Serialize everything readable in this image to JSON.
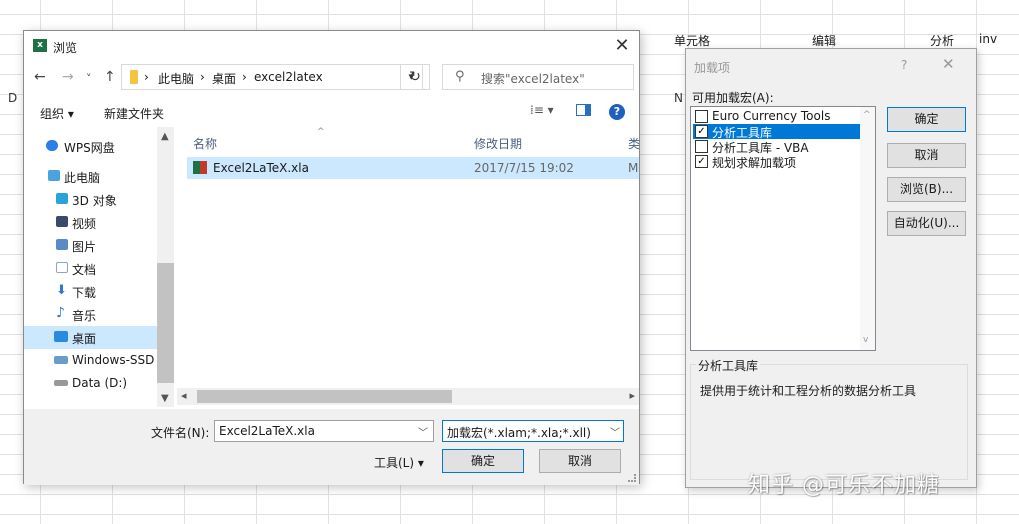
{
  "excel": {
    "ribbon": {
      "cell": "单元格",
      "edit": "编辑",
      "analyze": "分析",
      "inv": "inv"
    },
    "columns": {
      "d": "D",
      "n": "N"
    }
  },
  "browse_dialog": {
    "title": "浏览",
    "app_icon": "x",
    "nav": {
      "back": "←",
      "forward": "→",
      "recent": "˅",
      "up": "↑"
    },
    "address": {
      "crumbs": [
        "此电脑",
        "桌面",
        "excel2latex"
      ],
      "sep": "›",
      "lead": "›"
    },
    "refresh_icon": "↻",
    "search_placeholder": "搜索\"excel2latex\"",
    "toolbar": {
      "organize": "组织 ▾",
      "new_folder": "新建文件夹",
      "view": "⁞≡ ▾"
    },
    "sidebar": {
      "items": [
        {
          "label": "WPS网盘",
          "icon": "cloud-icon",
          "color": "#2b7de9"
        },
        {
          "label": "此电脑",
          "icon": "computer-icon",
          "color": "#4aa3df"
        },
        {
          "label": "3D 对象",
          "icon": "cube-icon",
          "color": "#29a3d9"
        },
        {
          "label": "视频",
          "icon": "video-icon",
          "color": "#3b4a6b"
        },
        {
          "label": "图片",
          "icon": "picture-icon",
          "color": "#5b8bc5"
        },
        {
          "label": "文档",
          "icon": "document-icon",
          "color": "#8aa6c8"
        },
        {
          "label": "下载",
          "icon": "download-icon",
          "color": "#2a7ad4"
        },
        {
          "label": "音乐",
          "icon": "music-icon",
          "color": "#2a7ad4"
        },
        {
          "label": "桌面",
          "icon": "desktop-icon",
          "color": "#2a8ae0"
        },
        {
          "label": "Windows-SSD (",
          "icon": "drive-icon",
          "color": "#6a9cc9"
        },
        {
          "label": "Data (D:)",
          "icon": "drive-icon",
          "color": "#999999"
        }
      ]
    },
    "columns": {
      "name": "名称",
      "date": "修改日期",
      "type": "类"
    },
    "files": [
      {
        "name": "Excel2LaTeX.xla",
        "date": "2017/7/15 19:02",
        "type": "M"
      }
    ],
    "filename_label": "文件名(N):",
    "filename_value": "Excel2LaTeX.xla",
    "filetype_value": "加载宏(*.xlam;*.xla;*.xll)",
    "tools_label": "工具(L)",
    "ok": "确定",
    "cancel": "取消"
  },
  "addins_dialog": {
    "title": "加载项",
    "help": "?",
    "close": "✕",
    "list_label": "可用加载宏(A):",
    "items": [
      {
        "label": "Euro Currency Tools",
        "checked": false,
        "selected": false
      },
      {
        "label": "分析工具库",
        "checked": true,
        "selected": true
      },
      {
        "label": "分析工具库 - VBA",
        "checked": false,
        "selected": false
      },
      {
        "label": "规划求解加载项",
        "checked": true,
        "selected": false
      }
    ],
    "buttons": {
      "ok": "确定",
      "cancel": "取消",
      "browse": "浏览(B)...",
      "automation": "自动化(U)..."
    },
    "group_title": "分析工具库",
    "description": "提供用于统计和工程分析的数据分析工具"
  },
  "watermark": "知乎 @可乐不加糖"
}
